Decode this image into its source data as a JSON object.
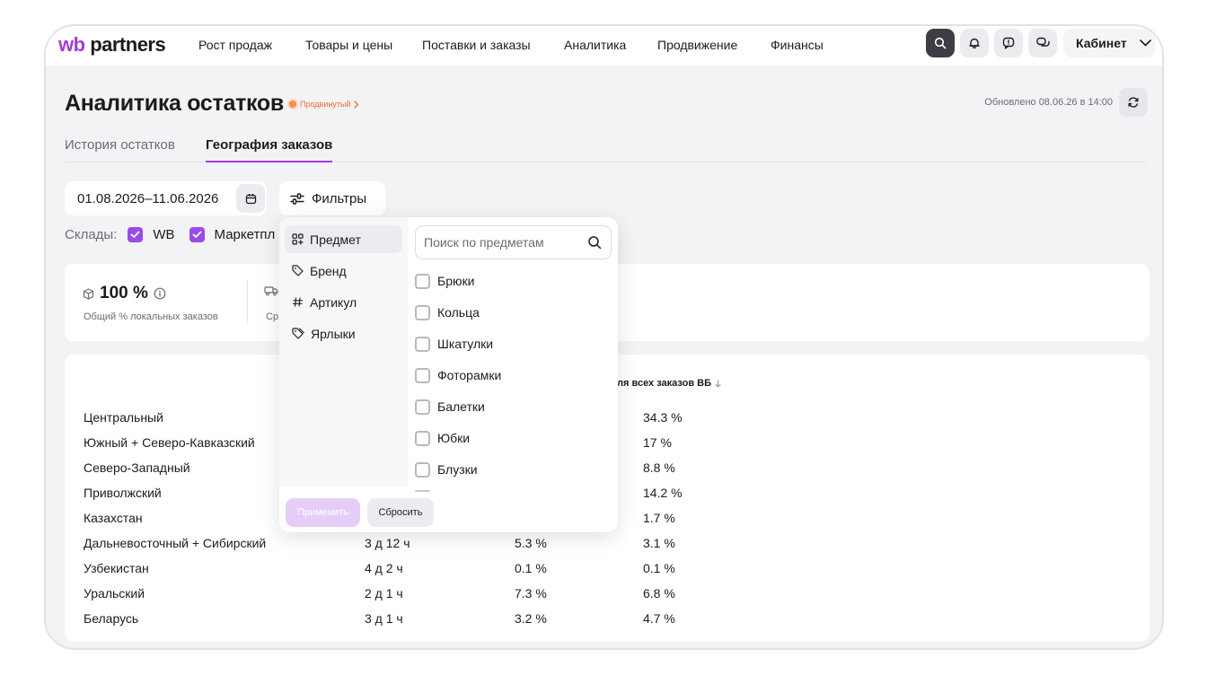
{
  "app": {
    "logo_wb": "wb",
    "logo_partners": "partners"
  },
  "nav": {
    "items": [
      "Рост продаж",
      "Товары и цены",
      "Поставки и заказы",
      "Аналитика",
      "Продвижение",
      "Финансы"
    ],
    "cabinet_label": "Кабинет",
    "icons": [
      "search-icon",
      "bell-icon",
      "feedback-icon",
      "chat-icon"
    ]
  },
  "page": {
    "title": "Аналитика остатков",
    "badge": "Продвинутый",
    "updated": "Обновлено 08.06.26 в 14:00"
  },
  "tabs": [
    {
      "label": "История остатков",
      "active": false
    },
    {
      "label": "География заказов",
      "active": true
    }
  ],
  "filters": {
    "date_range": "01.08.2026–11.06.2026",
    "filters_label": "Фильтры",
    "warehouses_label": "Склады:",
    "warehouses": [
      {
        "label": "WB",
        "checked": true
      },
      {
        "label": "Маркетпл",
        "checked": true
      }
    ]
  },
  "kpi": {
    "value": "100 %",
    "sub": "Общий % локальных заказов",
    "sub2": "Ср"
  },
  "table": {
    "header_last": "ля всех заказов ВБ",
    "rows": [
      {
        "region": "Центральный",
        "time": "",
        "share": "",
        "wb_share": "34.3 %"
      },
      {
        "region": "Южный + Северо-Кавказский",
        "time": "",
        "share": "",
        "wb_share": "17 %"
      },
      {
        "region": "Северо-Западный",
        "time": "",
        "share": "",
        "wb_share": "8.8 %"
      },
      {
        "region": "Приволжский",
        "time": "",
        "share": "",
        "wb_share": "14.2 %"
      },
      {
        "region": "Казахстан",
        "time": "",
        "share": "",
        "wb_share": "1.7 %"
      },
      {
        "region": "Дальневосточный + Сибирский",
        "time": "3 д 12 ч",
        "share": "5.3 %",
        "wb_share": "3.1 %"
      },
      {
        "region": "Узбекистан",
        "time": "4 д 2 ч",
        "share": "0.1 %",
        "wb_share": "0.1 %"
      },
      {
        "region": "Уральский",
        "time": "2 д 1 ч",
        "share": "7.3 %",
        "wb_share": "6.8 %"
      },
      {
        "region": "Беларусь",
        "time": "3 д 1 ч",
        "share": "3.2 %",
        "wb_share": "4.7 %"
      }
    ]
  },
  "popup": {
    "categories": [
      {
        "label": "Предмет",
        "icon": "grid-icon",
        "selected": true
      },
      {
        "label": "Бренд",
        "icon": "tag-icon",
        "selected": false
      },
      {
        "label": "Артикул",
        "icon": "hash-icon",
        "selected": false
      },
      {
        "label": "Ярлыки",
        "icon": "tags-icon",
        "selected": false
      }
    ],
    "search_placeholder": "Поиск по предметам",
    "items": [
      "Брюки",
      "Кольца",
      "Шкатулки",
      "Фоторамки",
      "Балетки",
      "Юбки",
      "Блузки"
    ],
    "apply_label": "Применить",
    "reset_label": "Сбросить"
  },
  "colors": {
    "accent": "#a23bd8",
    "checkbox": "#9b4ae8",
    "badge": "#f26b2a",
    "apply_disabled": "#e6cdf8"
  }
}
